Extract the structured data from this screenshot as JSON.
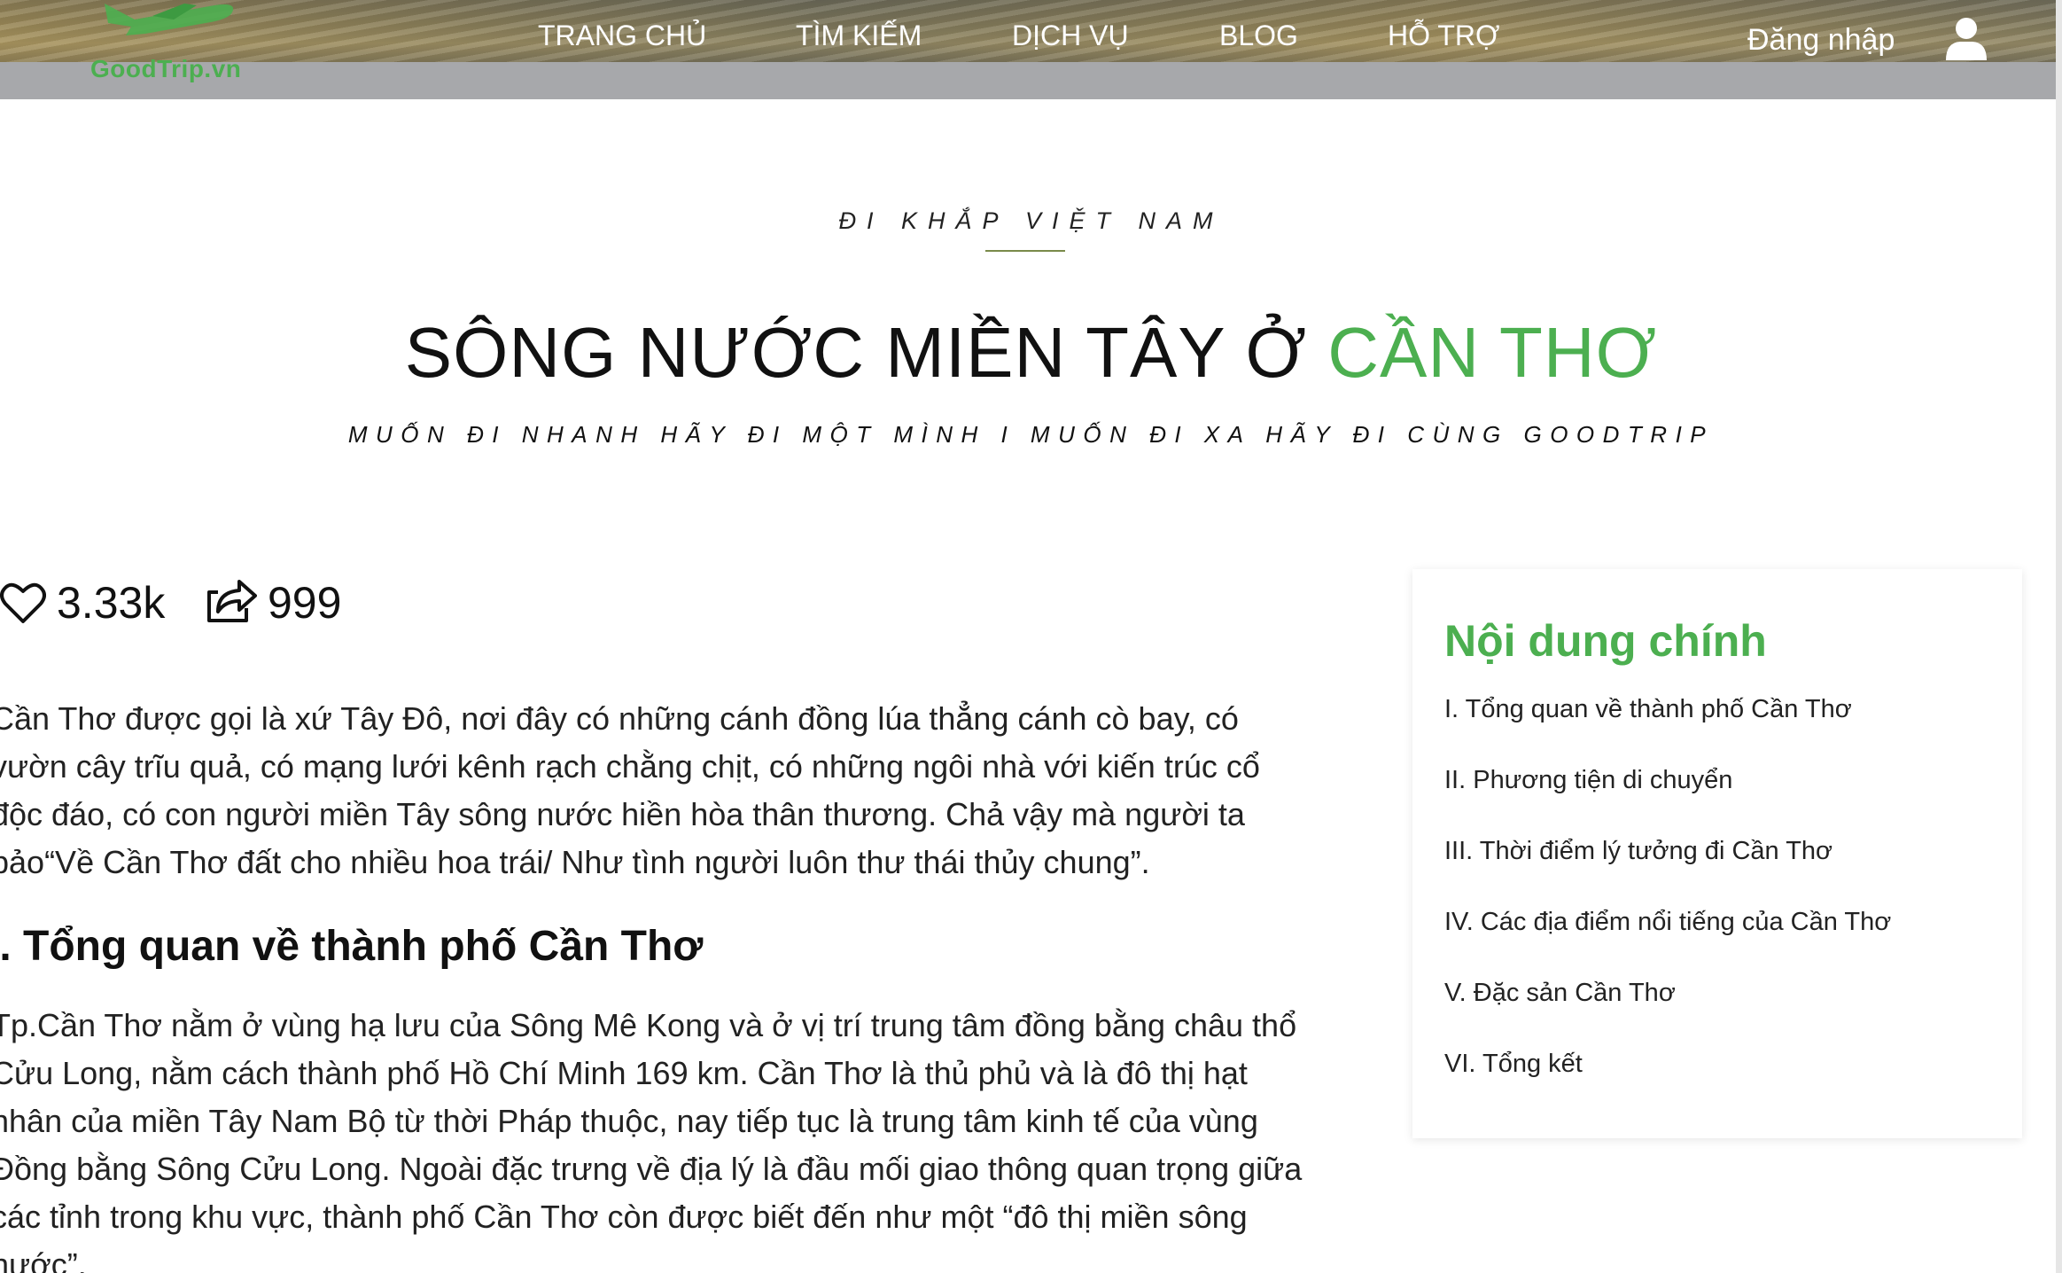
{
  "header": {
    "logo_text": "GoodTrip.vn",
    "nav": [
      "TRANG CHỦ",
      "TÌM KIẾM",
      "DỊCH VỤ",
      "BLOG",
      "HỖ TRỢ"
    ],
    "login_label": "Đăng nhập",
    "icons": {
      "logo": "plane-logo-icon",
      "user": "user-icon"
    }
  },
  "hero": {
    "kicker": "ĐI KHẮP VIỆT NAM",
    "title_main": "SÔNG NƯỚC MIỀN TÂY Ở ",
    "title_accent": "CẦN THƠ",
    "tagline": "MUỐN ĐI NHANH HÃY ĐI MỘT MÌNH I MUỐN ĐI XA HÃY ĐI CÙNG GOODTRIP"
  },
  "stats": {
    "likes": "3.33k",
    "shares": "999",
    "icons": {
      "likes": "heart-icon",
      "shares": "share-icon"
    }
  },
  "article": {
    "intro_lines": [
      "Cần Thơ được gọi là xứ Tây Đô, nơi đây có những cánh đồng lúa thẳng cánh cò bay, có",
      "vườn cây trĩu quả, có mạng lưới kênh rạch chằng chịt, có những ngôi nhà với kiến trúc cổ",
      "độc đáo, có con người miền Tây sông nước hiền hòa thân thương. Chả vậy mà người ta",
      "bảo“Về Cần Thơ đất cho nhiều hoa trái/ Như tình người luôn thư thái thủy chung”."
    ],
    "section1_heading": "I. Tổng quan về thành phố Cần Thơ",
    "section1_lines": [
      "Tp.Cần Thơ nằm ở vùng hạ lưu của Sông Mê Kong và ở vị trí trung tâm đồng bằng châu thổ",
      "Cửu Long, nằm cách thành phố Hồ Chí Minh 169 km. Cần Thơ là thủ phủ và là đô thị hạt",
      "nhân của miền Tây Nam Bộ từ thời Pháp thuộc, nay tiếp tục là trung tâm kinh tế của vùng",
      "Đồng bằng Sông Cửu Long. Ngoài đặc trưng về địa lý là đầu mối giao thông quan trọng giữa",
      "các tỉnh trong khu vực, thành phố Cần Thơ còn được biết đến như một “đô thị miền sông",
      "nước”."
    ]
  },
  "toc": {
    "title": "Nội dung chính",
    "items": [
      "I. Tổng quan về thành phố Cần Thơ",
      "II. Phương tiện di chuyển",
      "III. Thời điểm lý tưởng đi Cần Thơ",
      "IV. Các địa điểm nổi tiếng của Cần Thơ",
      "V. Đặc sản Cần Thơ",
      "VI. Tổng kết"
    ]
  },
  "colors": {
    "accent_green": "#4caf50",
    "header_band": "#a7a8ab"
  }
}
